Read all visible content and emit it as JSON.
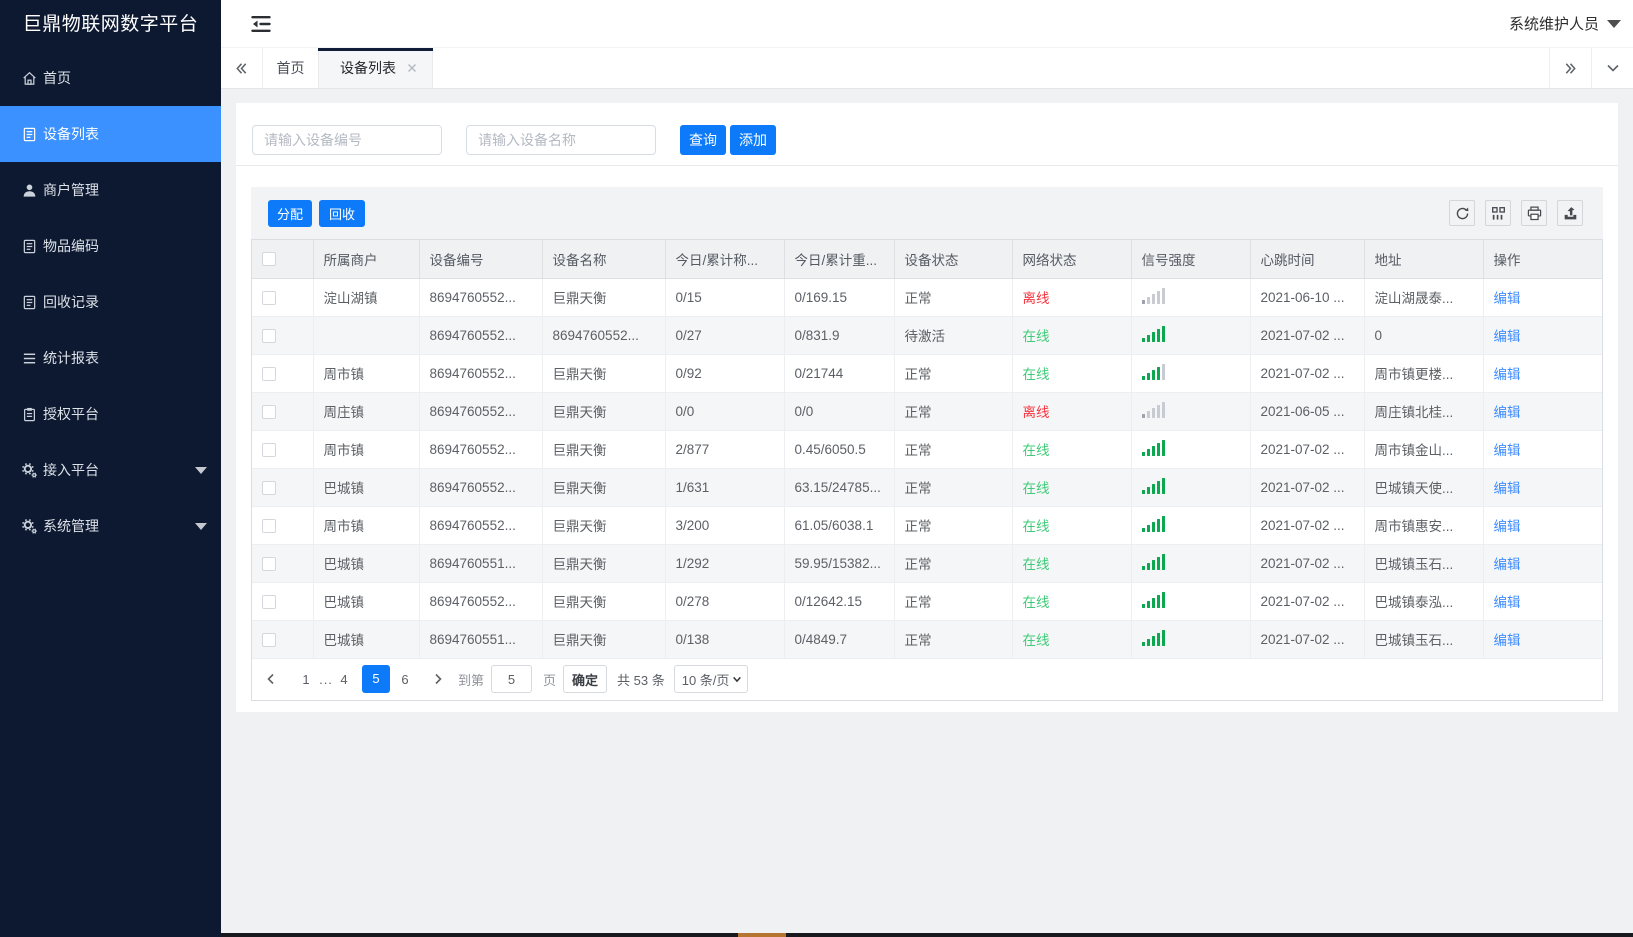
{
  "colors": {
    "primary_button_blue": "#0d7bf9",
    "sidebar_active_blue": "#3a91ff",
    "sidebar_background": "#0c1931",
    "online_green": "#3ecb77",
    "signal_bar_green": "#0ca74f",
    "offline_red": "#f8333c",
    "edit_link_blue": "#3f8cff",
    "page_background": "#f0f1f3"
  },
  "sidebar": {
    "title": "巨鼎物联网数字平台",
    "items": [
      {
        "label": "首页",
        "icon": "home"
      },
      {
        "label": "设备列表",
        "icon": "device-list",
        "active": true
      },
      {
        "label": "商户管理",
        "icon": "merchant"
      },
      {
        "label": "物品编码",
        "icon": "item-code"
      },
      {
        "label": "回收记录",
        "icon": "recycle-record"
      },
      {
        "label": "统计报表",
        "icon": "report"
      },
      {
        "label": "授权平台",
        "icon": "authorize"
      },
      {
        "label": "接入平台",
        "icon": "access-platform",
        "submenu": true
      },
      {
        "label": "系统管理",
        "icon": "system-manage",
        "submenu": true
      }
    ]
  },
  "topbar": {
    "user_name": "系统维护人员"
  },
  "tabs": {
    "items": [
      {
        "label": "首页"
      },
      {
        "label": "设备列表",
        "active": true,
        "closable": true
      }
    ]
  },
  "search": {
    "device_no_placeholder": "请输入设备编号",
    "device_name_placeholder": "请输入设备名称",
    "query_label": "查询",
    "add_label": "添加"
  },
  "toolbar": {
    "assign_label": "分配",
    "recycle_label": "回收"
  },
  "table": {
    "columns": [
      "所属商户",
      "设备编号",
      "设备名称",
      "今日/累计称...",
      "今日/累计重...",
      "设备状态",
      "网络状态",
      "信号强度",
      "心跳时间",
      "地址",
      "操作"
    ],
    "rows": [
      {
        "merchant": "淀山湖镇",
        "device_no": "8694760552...",
        "device_name": "巨鼎天衡",
        "today_count": "0/15",
        "today_weight": "0/169.15",
        "device_status": "正常",
        "network_status": "离线",
        "online": false,
        "signal_level": 1,
        "heartbeat": "2021-06-10 ...",
        "address": "淀山湖晟泰...",
        "action": "编辑"
      },
      {
        "merchant": "",
        "device_no": "8694760552...",
        "device_name": "8694760552...",
        "today_count": "0/27",
        "today_weight": "0/831.9",
        "device_status": "待激活",
        "network_status": "在线",
        "online": true,
        "signal_level": 5,
        "heartbeat": "2021-07-02 ...",
        "address": "0",
        "action": "编辑"
      },
      {
        "merchant": "周市镇",
        "device_no": "8694760552...",
        "device_name": "巨鼎天衡",
        "today_count": "0/92",
        "today_weight": "0/21744",
        "device_status": "正常",
        "network_status": "在线",
        "online": true,
        "signal_level": 4,
        "heartbeat": "2021-07-02 ...",
        "address": "周市镇更楼...",
        "action": "编辑"
      },
      {
        "merchant": "周庄镇",
        "device_no": "8694760552...",
        "device_name": "巨鼎天衡",
        "today_count": "0/0",
        "today_weight": "0/0",
        "device_status": "正常",
        "network_status": "离线",
        "online": false,
        "signal_level": 1,
        "heartbeat": "2021-06-05 ...",
        "address": "周庄镇北桂...",
        "action": "编辑"
      },
      {
        "merchant": "周市镇",
        "device_no": "8694760552...",
        "device_name": "巨鼎天衡",
        "today_count": "2/877",
        "today_weight": "0.45/6050.5",
        "device_status": "正常",
        "network_status": "在线",
        "online": true,
        "signal_level": 5,
        "heartbeat": "2021-07-02 ...",
        "address": "周市镇金山...",
        "action": "编辑"
      },
      {
        "merchant": "巴城镇",
        "device_no": "8694760552...",
        "device_name": "巨鼎天衡",
        "today_count": "1/631",
        "today_weight": "63.15/24785...",
        "device_status": "正常",
        "network_status": "在线",
        "online": true,
        "signal_level": 5,
        "heartbeat": "2021-07-02 ...",
        "address": "巴城镇天使...",
        "action": "编辑"
      },
      {
        "merchant": "周市镇",
        "device_no": "8694760552...",
        "device_name": "巨鼎天衡",
        "today_count": "3/200",
        "today_weight": "61.05/6038.1",
        "device_status": "正常",
        "network_status": "在线",
        "online": true,
        "signal_level": 5,
        "heartbeat": "2021-07-02 ...",
        "address": "周市镇惠安...",
        "action": "编辑"
      },
      {
        "merchant": "巴城镇",
        "device_no": "8694760551...",
        "device_name": "巨鼎天衡",
        "today_count": "1/292",
        "today_weight": "59.95/15382...",
        "device_status": "正常",
        "network_status": "在线",
        "online": true,
        "signal_level": 5,
        "heartbeat": "2021-07-02 ...",
        "address": "巴城镇玉石...",
        "action": "编辑"
      },
      {
        "merchant": "巴城镇",
        "device_no": "8694760552...",
        "device_name": "巨鼎天衡",
        "today_count": "0/278",
        "today_weight": "0/12642.15",
        "device_status": "正常",
        "network_status": "在线",
        "online": true,
        "signal_level": 5,
        "heartbeat": "2021-07-02 ...",
        "address": "巴城镇泰泓...",
        "action": "编辑"
      },
      {
        "merchant": "巴城镇",
        "device_no": "8694760551...",
        "device_name": "巨鼎天衡",
        "today_count": "0/138",
        "today_weight": "0/4849.7",
        "device_status": "正常",
        "network_status": "在线",
        "online": true,
        "signal_level": 5,
        "heartbeat": "2021-07-02 ...",
        "address": "巴城镇玉石...",
        "action": "编辑"
      }
    ]
  },
  "pagination": {
    "pages": [
      {
        "label": "1"
      },
      {
        "label": "...",
        "ellipsis": true
      },
      {
        "label": "4"
      },
      {
        "label": "5",
        "active": true
      },
      {
        "label": "6"
      }
    ],
    "goto_label": "到第",
    "goto_value": "5",
    "page_unit_label": "页",
    "confirm_label": "确定",
    "total_label": "共 53 条",
    "page_size_value": "10 条/页"
  }
}
